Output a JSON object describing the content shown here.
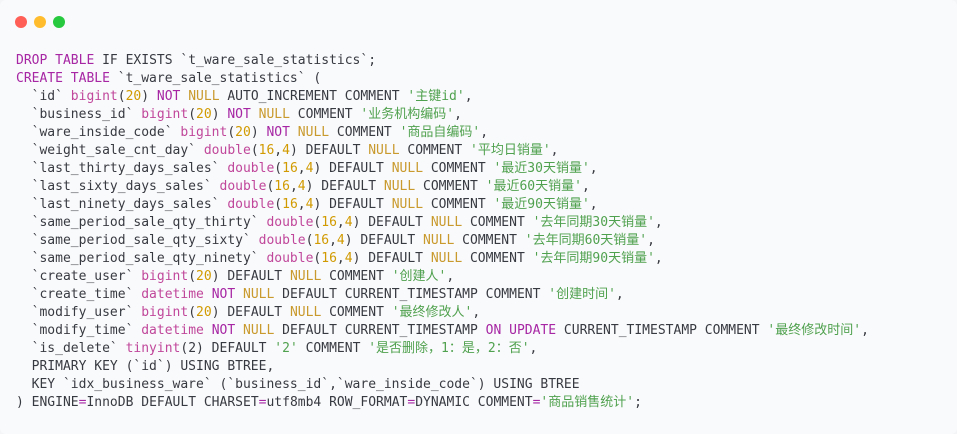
{
  "window": {
    "controls": [
      {
        "name": "close",
        "color": "#ff5f56"
      },
      {
        "name": "minimize",
        "color": "#ffbd2e"
      },
      {
        "name": "maximize",
        "color": "#27c93f"
      }
    ]
  },
  "colors": {
    "keyword": "#a626a4",
    "type": "#c0479b",
    "number": "#d19a00",
    "null": "#c99a2e",
    "string": "#50a14f",
    "plain": "#383a42"
  },
  "code_lines": [
    [
      [
        "kw",
        "DROP TABLE"
      ],
      [
        "pl",
        " IF EXISTS `t_ware_sale_statistics`;"
      ]
    ],
    [
      [
        "kw",
        "CREATE TABLE"
      ],
      [
        "pl",
        " `t_ware_sale_statistics` ("
      ]
    ],
    [
      [
        "pl",
        "  `id` "
      ],
      [
        "ty",
        "bigint"
      ],
      [
        "pl",
        "("
      ],
      [
        "nu",
        "20"
      ],
      [
        "pl",
        ") "
      ],
      [
        "kw",
        "NOT"
      ],
      [
        "pl",
        " "
      ],
      [
        "nl",
        "NULL"
      ],
      [
        "pl",
        " AUTO_INCREMENT COMMENT "
      ],
      [
        "st",
        "'主键id'"
      ],
      [
        "pl",
        ","
      ]
    ],
    [
      [
        "pl",
        "  `business_id` "
      ],
      [
        "ty",
        "bigint"
      ],
      [
        "pl",
        "("
      ],
      [
        "nu",
        "20"
      ],
      [
        "pl",
        ") "
      ],
      [
        "kw",
        "NOT"
      ],
      [
        "pl",
        " "
      ],
      [
        "nl",
        "NULL"
      ],
      [
        "pl",
        " COMMENT "
      ],
      [
        "st",
        "'业务机构编码'"
      ],
      [
        "pl",
        ","
      ]
    ],
    [
      [
        "pl",
        "  `ware_inside_code` "
      ],
      [
        "ty",
        "bigint"
      ],
      [
        "pl",
        "("
      ],
      [
        "nu",
        "20"
      ],
      [
        "pl",
        ") "
      ],
      [
        "kw",
        "NOT"
      ],
      [
        "pl",
        " "
      ],
      [
        "nl",
        "NULL"
      ],
      [
        "pl",
        " COMMENT "
      ],
      [
        "st",
        "'商品自编码'"
      ],
      [
        "pl",
        ","
      ]
    ],
    [
      [
        "pl",
        "  `weight_sale_cnt_day` "
      ],
      [
        "ty",
        "double"
      ],
      [
        "pl",
        "("
      ],
      [
        "nu",
        "16"
      ],
      [
        "pl",
        ","
      ],
      [
        "nu",
        "4"
      ],
      [
        "pl",
        ") DEFAULT "
      ],
      [
        "nl",
        "NULL"
      ],
      [
        "pl",
        " COMMENT "
      ],
      [
        "st",
        "'平均日销量'"
      ],
      [
        "pl",
        ","
      ]
    ],
    [
      [
        "pl",
        "  `last_thirty_days_sales` "
      ],
      [
        "ty",
        "double"
      ],
      [
        "pl",
        "("
      ],
      [
        "nu",
        "16"
      ],
      [
        "pl",
        ","
      ],
      [
        "nu",
        "4"
      ],
      [
        "pl",
        ") DEFAULT "
      ],
      [
        "nl",
        "NULL"
      ],
      [
        "pl",
        " COMMENT "
      ],
      [
        "st",
        "'最近30天销量'"
      ],
      [
        "pl",
        ","
      ]
    ],
    [
      [
        "pl",
        "  `last_sixty_days_sales` "
      ],
      [
        "ty",
        "double"
      ],
      [
        "pl",
        "("
      ],
      [
        "nu",
        "16"
      ],
      [
        "pl",
        ","
      ],
      [
        "nu",
        "4"
      ],
      [
        "pl",
        ") DEFAULT "
      ],
      [
        "nl",
        "NULL"
      ],
      [
        "pl",
        " COMMENT "
      ],
      [
        "st",
        "'最近60天销量'"
      ],
      [
        "pl",
        ","
      ]
    ],
    [
      [
        "pl",
        "  `last_ninety_days_sales` "
      ],
      [
        "ty",
        "double"
      ],
      [
        "pl",
        "("
      ],
      [
        "nu",
        "16"
      ],
      [
        "pl",
        ","
      ],
      [
        "nu",
        "4"
      ],
      [
        "pl",
        ") DEFAULT "
      ],
      [
        "nl",
        "NULL"
      ],
      [
        "pl",
        " COMMENT "
      ],
      [
        "st",
        "'最近90天销量'"
      ],
      [
        "pl",
        ","
      ]
    ],
    [
      [
        "pl",
        "  `same_period_sale_qty_thirty` "
      ],
      [
        "ty",
        "double"
      ],
      [
        "pl",
        "("
      ],
      [
        "nu",
        "16"
      ],
      [
        "pl",
        ","
      ],
      [
        "nu",
        "4"
      ],
      [
        "pl",
        ") DEFAULT "
      ],
      [
        "nl",
        "NULL"
      ],
      [
        "pl",
        " COMMENT "
      ],
      [
        "st",
        "'去年同期30天销量'"
      ],
      [
        "pl",
        ","
      ]
    ],
    [
      [
        "pl",
        "  `same_period_sale_qty_sixty` "
      ],
      [
        "ty",
        "double"
      ],
      [
        "pl",
        "("
      ],
      [
        "nu",
        "16"
      ],
      [
        "pl",
        ","
      ],
      [
        "nu",
        "4"
      ],
      [
        "pl",
        ") DEFAULT "
      ],
      [
        "nl",
        "NULL"
      ],
      [
        "pl",
        " COMMENT "
      ],
      [
        "st",
        "'去年同期60天销量'"
      ],
      [
        "pl",
        ","
      ]
    ],
    [
      [
        "pl",
        "  `same_period_sale_qty_ninety` "
      ],
      [
        "ty",
        "double"
      ],
      [
        "pl",
        "("
      ],
      [
        "nu",
        "16"
      ],
      [
        "pl",
        ","
      ],
      [
        "nu",
        "4"
      ],
      [
        "pl",
        ") DEFAULT "
      ],
      [
        "nl",
        "NULL"
      ],
      [
        "pl",
        " COMMENT "
      ],
      [
        "st",
        "'去年同期90天销量'"
      ],
      [
        "pl",
        ","
      ]
    ],
    [
      [
        "pl",
        "  `create_user` "
      ],
      [
        "ty",
        "bigint"
      ],
      [
        "pl",
        "("
      ],
      [
        "nu",
        "20"
      ],
      [
        "pl",
        ") DEFAULT "
      ],
      [
        "nl",
        "NULL"
      ],
      [
        "pl",
        " COMMENT "
      ],
      [
        "st",
        "'创建人'"
      ],
      [
        "pl",
        ","
      ]
    ],
    [
      [
        "pl",
        "  `create_time` "
      ],
      [
        "ty",
        "datetime"
      ],
      [
        "pl",
        " "
      ],
      [
        "kw",
        "NOT"
      ],
      [
        "pl",
        " "
      ],
      [
        "nl",
        "NULL"
      ],
      [
        "pl",
        " DEFAULT CURRENT_TIMESTAMP COMMENT "
      ],
      [
        "st",
        "'创建时间'"
      ],
      [
        "pl",
        ","
      ]
    ],
    [
      [
        "pl",
        "  `modify_user` "
      ],
      [
        "ty",
        "bigint"
      ],
      [
        "pl",
        "("
      ],
      [
        "nu",
        "20"
      ],
      [
        "pl",
        ") DEFAULT "
      ],
      [
        "nl",
        "NULL"
      ],
      [
        "pl",
        " COMMENT "
      ],
      [
        "st",
        "'最终修改人'"
      ],
      [
        "pl",
        ","
      ]
    ],
    [
      [
        "pl",
        "  `modify_time` "
      ],
      [
        "ty",
        "datetime"
      ],
      [
        "pl",
        " "
      ],
      [
        "kw",
        "NOT"
      ],
      [
        "pl",
        " "
      ],
      [
        "nl",
        "NULL"
      ],
      [
        "pl",
        " DEFAULT CURRENT_TIMESTAMP "
      ],
      [
        "kw",
        "ON UPDATE"
      ],
      [
        "pl",
        " CURRENT_TIMESTAMP COMMENT "
      ],
      [
        "st",
        "'最终修改时间'"
      ],
      [
        "pl",
        ","
      ]
    ],
    [
      [
        "pl",
        "  `is_delete` "
      ],
      [
        "ty",
        "tinyint"
      ],
      [
        "pl",
        "(2) DEFAULT "
      ],
      [
        "st",
        "'2'"
      ],
      [
        "pl",
        " COMMENT "
      ],
      [
        "st",
        "'是否删除，1：是，2：否'"
      ],
      [
        "pl",
        ","
      ]
    ],
    [
      [
        "pl",
        "  PRIMARY KEY (`id`) USING BTREE,"
      ]
    ],
    [
      [
        "pl",
        "  KEY `idx_business_ware` (`business_id`,`ware_inside_code`) USING BTREE"
      ]
    ],
    [
      [
        "pl",
        ") ENGINE"
      ],
      [
        "kw",
        "="
      ],
      [
        "pl",
        "InnoDB DEFAULT CHARSET"
      ],
      [
        "kw",
        "="
      ],
      [
        "pl",
        "utf8mb4 ROW_FORMAT"
      ],
      [
        "kw",
        "="
      ],
      [
        "pl",
        "DYNAMIC COMMENT"
      ],
      [
        "kw",
        "="
      ],
      [
        "st",
        "'商品销售统计'"
      ],
      [
        "pl",
        ";"
      ]
    ]
  ]
}
